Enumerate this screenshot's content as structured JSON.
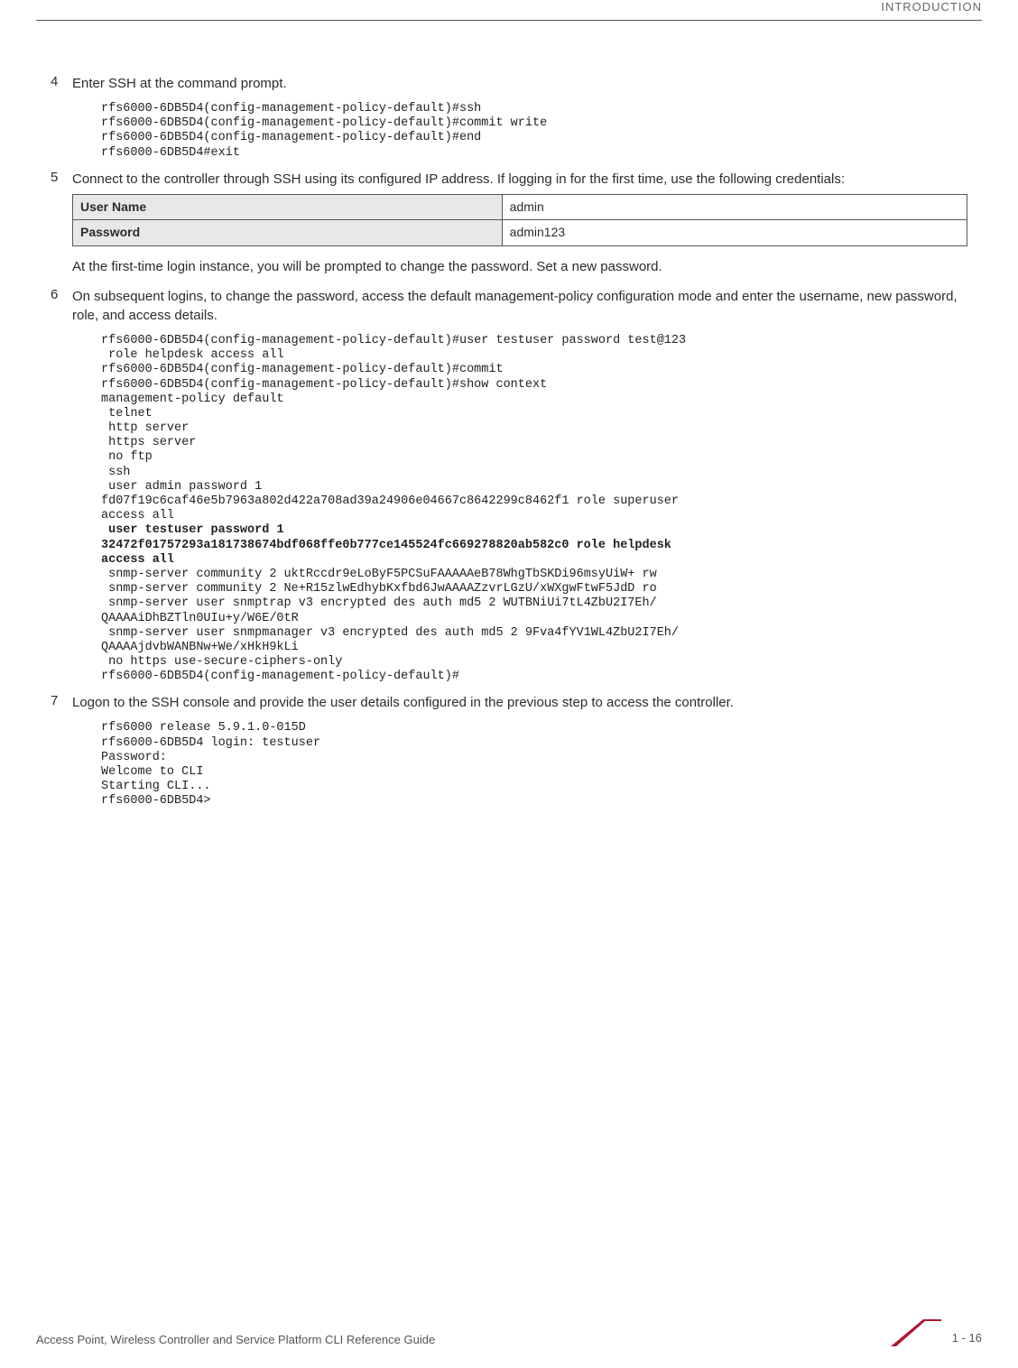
{
  "header": {
    "section": "INTRODUCTION"
  },
  "steps": {
    "s4": {
      "num": "4",
      "text": "Enter SSH at the command prompt."
    },
    "s5": {
      "num": "5",
      "text": "Connect to the controller through SSH using its configured IP address. If logging in for the first time, use the following credentials:"
    },
    "s6": {
      "num": "6",
      "text": "On subsequent logins, to change the password, access the default management-policy configuration mode and enter the username, new password, role, and access details."
    },
    "s7": {
      "num": "7",
      "text": "Logon to the SSH console and provide the user details configured in the previous step to access the controller."
    }
  },
  "code": {
    "c4": "rfs6000-6DB5D4(config-management-policy-default)#ssh\nrfs6000-6DB5D4(config-management-policy-default)#commit write\nrfs6000-6DB5D4(config-management-policy-default)#end\nrfs6000-6DB5D4#exit",
    "c6a": "rfs6000-6DB5D4(config-management-policy-default)#user testuser password test@123\n role helpdesk access all\nrfs6000-6DB5D4(config-management-policy-default)#commit\nrfs6000-6DB5D4(config-management-policy-default)#show context\nmanagement-policy default\n telnet\n http server\n https server\n no ftp\n ssh\n user admin password 1 \nfd07f19c6caf46e5b7963a802d422a708ad39a24906e04667c8642299c8462f1 role superuser \naccess all",
    "c6b": " user testuser password 1 \n32472f01757293a181738674bdf068ffe0b777ce145524fc669278820ab582c0 role helpdesk \naccess all",
    "c6c": " snmp-server community 2 uktRccdr9eLoByF5PCSuFAAAAAeB78WhgTbSKDi96msyUiW+ rw\n snmp-server community 2 Ne+R15zlwEdhybKxfbd6JwAAAAZzvrLGzU/xWXgwFtwF5JdD ro\n snmp-server user snmptrap v3 encrypted des auth md5 2 WUTBNiUi7tL4ZbU2I7Eh/\nQAAAAiDhBZTln0UIu+y/W6E/0tR\n snmp-server user snmpmanager v3 encrypted des auth md5 2 9Fva4fYV1WL4ZbU2I7Eh/\nQAAAAjdvbWANBNw+We/xHkH9kLi\n no https use-secure-ciphers-only\nrfs6000-6DB5D4(config-management-policy-default)#",
    "c7": "rfs6000 release 5.9.1.0-015D\nrfs6000-6DB5D4 login: testuser\nPassword:\nWelcome to CLI\nStarting CLI...\nrfs6000-6DB5D4>"
  },
  "table": {
    "row1": {
      "label": "User Name",
      "value": "admin"
    },
    "row2": {
      "label": "Password",
      "value": "admin123"
    }
  },
  "note": "At the first-time login instance, you will be prompted to change the password. Set a new password.",
  "footer": {
    "title": "Access Point, Wireless Controller and Service Platform CLI Reference Guide",
    "page": "1 - 16"
  }
}
